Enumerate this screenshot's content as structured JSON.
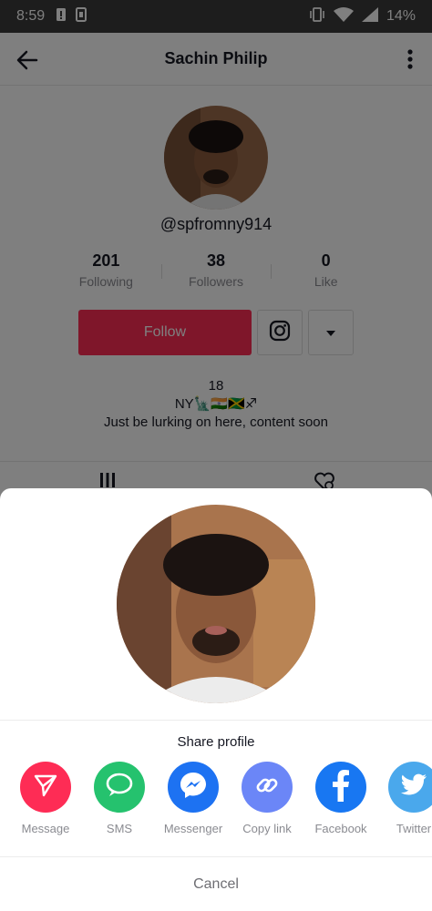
{
  "status_bar": {
    "time": "8:59",
    "battery": "14%",
    "icons": [
      "alert-icon",
      "sim-icon",
      "vibrate-icon",
      "wifi-icon",
      "signal-icon"
    ]
  },
  "header": {
    "title": "Sachin Philip",
    "back_icon": "arrow-left-icon",
    "more_icon": "more-vertical-icon"
  },
  "profile": {
    "username": "@spfromny914",
    "stats": [
      {
        "value": "201",
        "label": "Following"
      },
      {
        "value": "38",
        "label": "Followers"
      },
      {
        "value": "0",
        "label": "Like"
      }
    ],
    "follow_label": "Follow",
    "bio": {
      "line1": "18",
      "line2": "NY🗽🇮🇳🇯🇲♐",
      "line3": "Just be lurking on here, content soon"
    }
  },
  "share_sheet": {
    "title": "Share profile",
    "options": [
      {
        "label": "Message",
        "icon": "send-icon",
        "color": "#fe2c55"
      },
      {
        "label": "SMS",
        "icon": "chat-bubble-icon",
        "color": "#25c26e"
      },
      {
        "label": "Messenger",
        "icon": "messenger-icon",
        "color": "#1d72f2"
      },
      {
        "label": "Copy link",
        "icon": "link-icon",
        "color": "#6b86f7"
      },
      {
        "label": "Facebook",
        "icon": "facebook-icon",
        "color": "#1877f2"
      },
      {
        "label": "Twitter",
        "icon": "twitter-icon",
        "color": "#4aa8ec"
      }
    ],
    "cancel_label": "Cancel"
  }
}
